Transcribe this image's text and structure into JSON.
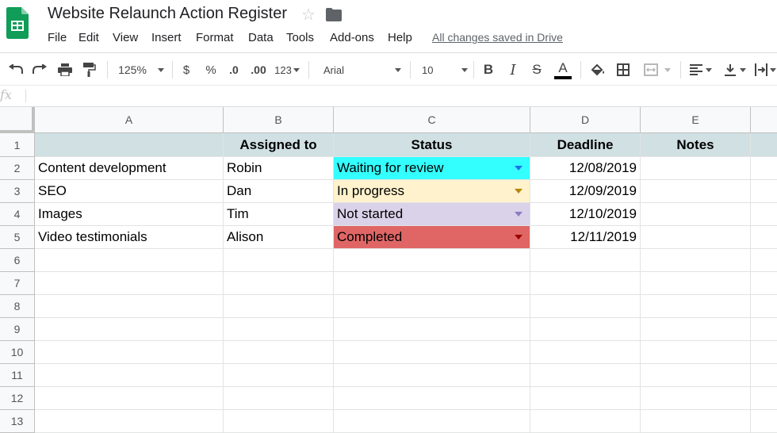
{
  "document": {
    "title": "Website Relaunch Action Register",
    "star_icon": "star-icon",
    "folder_icon": "folder-icon",
    "saved_status": "All changes saved in Drive"
  },
  "menu": [
    "File",
    "Edit",
    "View",
    "Insert",
    "Format",
    "Data",
    "Tools",
    "Add-ons",
    "Help"
  ],
  "toolbar": {
    "zoom": "125%",
    "currency": "$",
    "percent": "%",
    "decrease_decimal": ".0",
    "increase_decimal": ".00",
    "more_formats": "123",
    "font": "Arial",
    "font_size": "10",
    "bold": "B",
    "italic": "I",
    "strikethrough": "S",
    "text_color": "A"
  },
  "formula_bar": {
    "fx_label": "fx",
    "value": ""
  },
  "columns": [
    "A",
    "B",
    "C",
    "D",
    "E"
  ],
  "rows": [
    "1",
    "2",
    "3",
    "4",
    "5",
    "6",
    "7",
    "8",
    "9",
    "10",
    "11",
    "12",
    "13"
  ],
  "sheet": {
    "headers": {
      "task": "",
      "assigned": "Assigned to",
      "status": "Status",
      "deadline": "Deadline",
      "notes": "Notes"
    },
    "records": [
      {
        "task": "Content development",
        "assigned": "Robin",
        "status": "Waiting for review",
        "deadline": "12/08/2019",
        "notes": ""
      },
      {
        "task": "SEO",
        "assigned": "Dan",
        "status": "In progress",
        "deadline": "12/09/2019",
        "notes": ""
      },
      {
        "task": "Images",
        "assigned": "Tim",
        "status": "Not started",
        "deadline": "12/10/2019",
        "notes": ""
      },
      {
        "task": "Video testimonials",
        "assigned": "Alison",
        "status": "Completed",
        "deadline": "12/11/2019",
        "notes": ""
      }
    ]
  },
  "colors": {
    "header_fill": "#d0e0e3",
    "status_waiting": "#33ffff",
    "status_in_progress": "#fff2cc",
    "status_not_started": "#d9d2e9",
    "status_completed": "#e06666",
    "arrow_waiting": "#1a73e8",
    "arrow_in_progress": "#b8860b",
    "arrow_not_started": "#8e7cc3",
    "arrow_completed": "#990000",
    "sheets_green": "#0f9d58"
  }
}
